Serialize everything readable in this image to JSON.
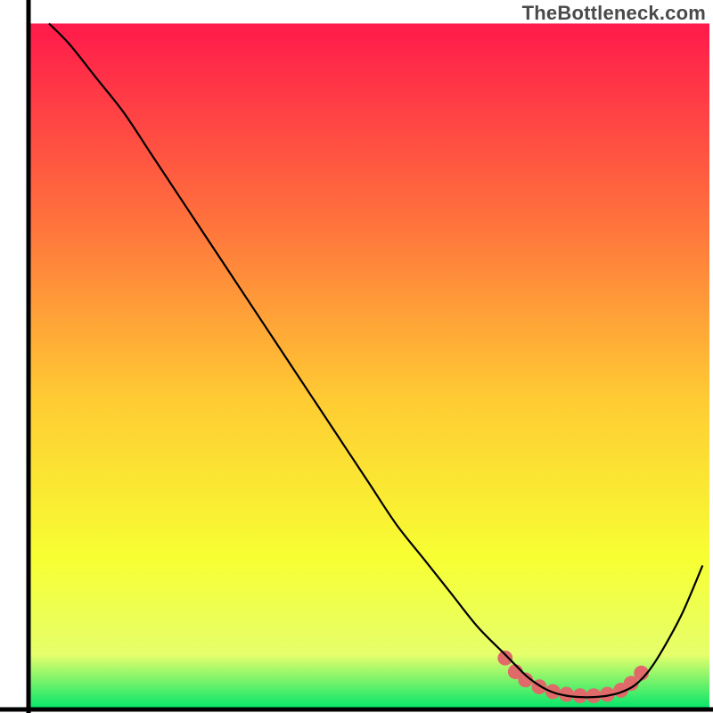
{
  "watermark": "TheBottleneck.com",
  "chart_data": {
    "type": "line",
    "title": "",
    "xlabel": "",
    "ylabel": "",
    "xlim": [
      0,
      100
    ],
    "ylim": [
      0,
      100
    ],
    "grid": false,
    "legend": false,
    "background_gradient": {
      "top_color": "#ff1a4b",
      "mid_top_color": "#ff6f3d",
      "mid_color": "#ffcc33",
      "mid_low_color": "#f7ff33",
      "low_color": "#e6ff6b",
      "bottom_color": "#00e56b"
    },
    "series": [
      {
        "name": "bottleneck-curve",
        "stroke": "#000000",
        "x": [
          3,
          6,
          10,
          14,
          18,
          22,
          26,
          30,
          34,
          38,
          42,
          46,
          50,
          54,
          58,
          62,
          66,
          70,
          73,
          75,
          77,
          79,
          81,
          83,
          85,
          87,
          89,
          91,
          93,
          96,
          99
        ],
        "y": [
          100,
          97,
          92,
          87,
          81,
          75,
          69,
          63,
          57,
          51,
          45,
          39,
          33,
          27,
          22,
          17,
          12,
          8,
          5,
          3.5,
          2.5,
          2,
          1.8,
          1.8,
          2,
          2.5,
          3.5,
          5.5,
          8.5,
          14,
          21
        ]
      }
    ],
    "markers": {
      "name": "highlight-dots",
      "color": "#e06a6a",
      "radius_percent": 1.1,
      "x": [
        70,
        71.5,
        73,
        75,
        77,
        79,
        81,
        83,
        85,
        87,
        88.5,
        90
      ],
      "y": [
        7.5,
        5.5,
        4.3,
        3.3,
        2.6,
        2.2,
        2.0,
        2.0,
        2.2,
        2.8,
        3.8,
        5.3
      ]
    },
    "plot_inset_percent": {
      "left": 4,
      "right": 0.5,
      "top": 3.3,
      "bottom": 0.5
    }
  }
}
